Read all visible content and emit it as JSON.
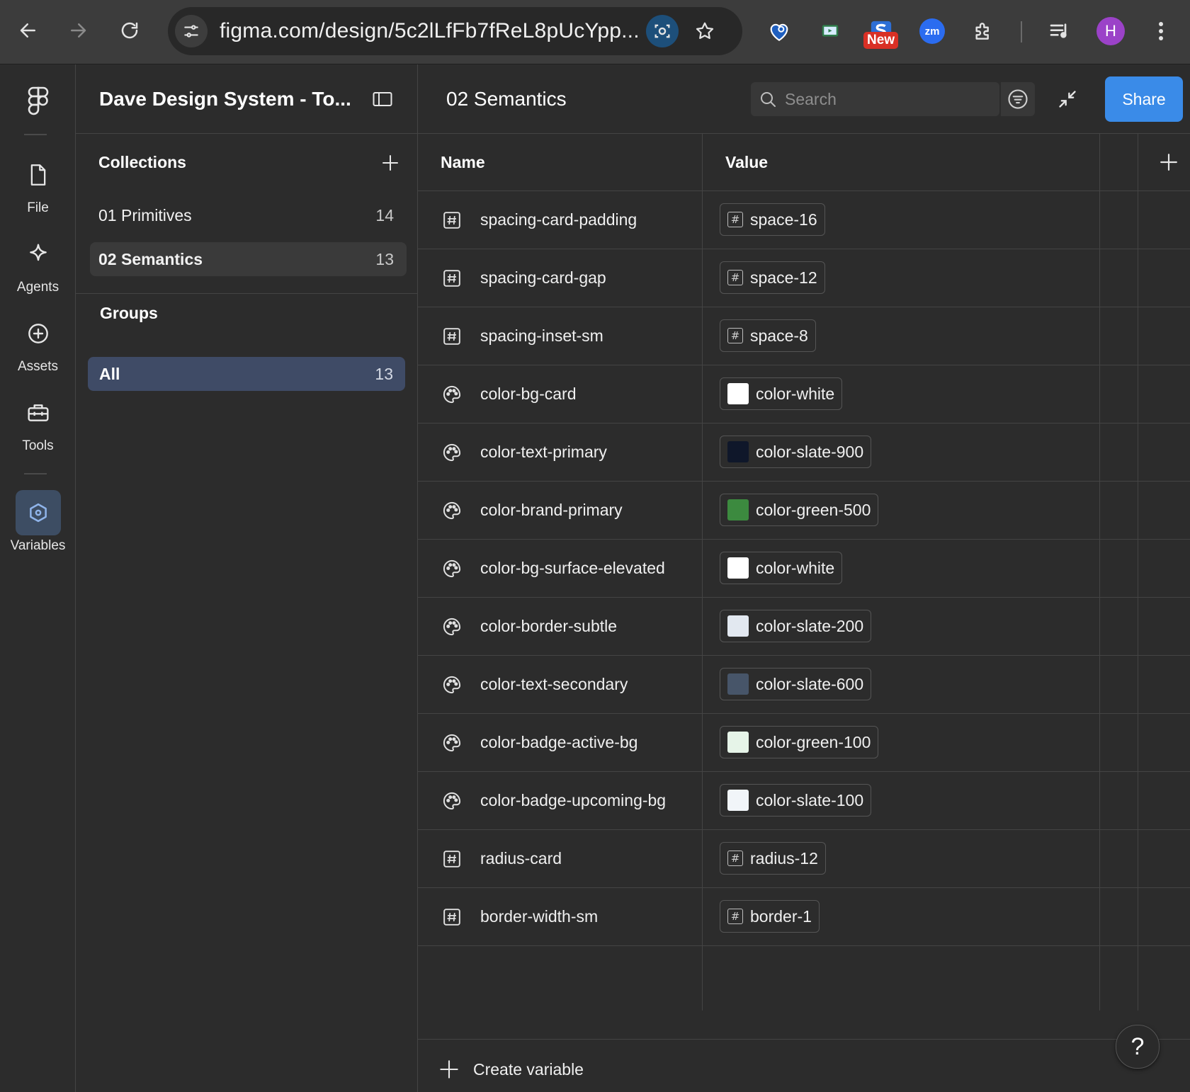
{
  "browser": {
    "url": "figma.com/design/5c2lLfFb7fReL8pUcYpp...",
    "new_badge": "New",
    "zoom_ext_label": "zm",
    "profile_initial": "H"
  },
  "rail": {
    "items": [
      {
        "label": "File",
        "icon": "file-icon"
      },
      {
        "label": "Agents",
        "icon": "sparkle-icon"
      },
      {
        "label": "Assets",
        "icon": "plus-circle-icon"
      },
      {
        "label": "Tools",
        "icon": "toolbox-icon"
      },
      {
        "label": "Variables",
        "icon": "hexagon-icon",
        "active": true
      }
    ]
  },
  "sidebar": {
    "file_title": "Dave Design System - To...",
    "collections_title": "Collections",
    "collections": [
      {
        "name": "01 Primitives",
        "count": "14"
      },
      {
        "name": "02 Semantics",
        "count": "13",
        "selected": true
      }
    ],
    "groups_title": "Groups",
    "groups": [
      {
        "name": "All",
        "count": "13",
        "selected": true
      }
    ]
  },
  "main": {
    "collection_title": "02 Semantics",
    "search_placeholder": "Search",
    "share_label": "Share",
    "columns": {
      "name": "Name",
      "value": "Value"
    },
    "create_label": "Create variable",
    "help_label": "?"
  },
  "variables": [
    {
      "name": "spacing-card-padding",
      "type": "number",
      "value": "space-16"
    },
    {
      "name": "spacing-card-gap",
      "type": "number",
      "value": "space-12"
    },
    {
      "name": "spacing-inset-sm",
      "type": "number",
      "value": "space-8"
    },
    {
      "name": "color-bg-card",
      "type": "color",
      "value": "color-white",
      "swatch": "#ffffff"
    },
    {
      "name": "color-text-primary",
      "type": "color",
      "value": "color-slate-900",
      "swatch": "#0f172a"
    },
    {
      "name": "color-brand-primary",
      "type": "color",
      "value": "color-green-500",
      "swatch": "#3c8a3f"
    },
    {
      "name": "color-bg-surface-elevated",
      "type": "color",
      "value": "color-white",
      "swatch": "#ffffff"
    },
    {
      "name": "color-border-subtle",
      "type": "color",
      "value": "color-slate-200",
      "swatch": "#e2e8f0"
    },
    {
      "name": "color-text-secondary",
      "type": "color",
      "value": "color-slate-600",
      "swatch": "#475569"
    },
    {
      "name": "color-badge-active-bg",
      "type": "color",
      "value": "color-green-100",
      "swatch": "#e6f4e8"
    },
    {
      "name": "color-badge-upcoming-bg",
      "type": "color",
      "value": "color-slate-100",
      "swatch": "#f1f5f9"
    },
    {
      "name": "radius-card",
      "type": "number",
      "value": "radius-12"
    },
    {
      "name": "border-width-sm",
      "type": "number",
      "value": "border-1"
    }
  ],
  "colors": {
    "accent": "#3a8be8",
    "group_selected": "#3f4b66",
    "background": "#2c2c2c"
  }
}
